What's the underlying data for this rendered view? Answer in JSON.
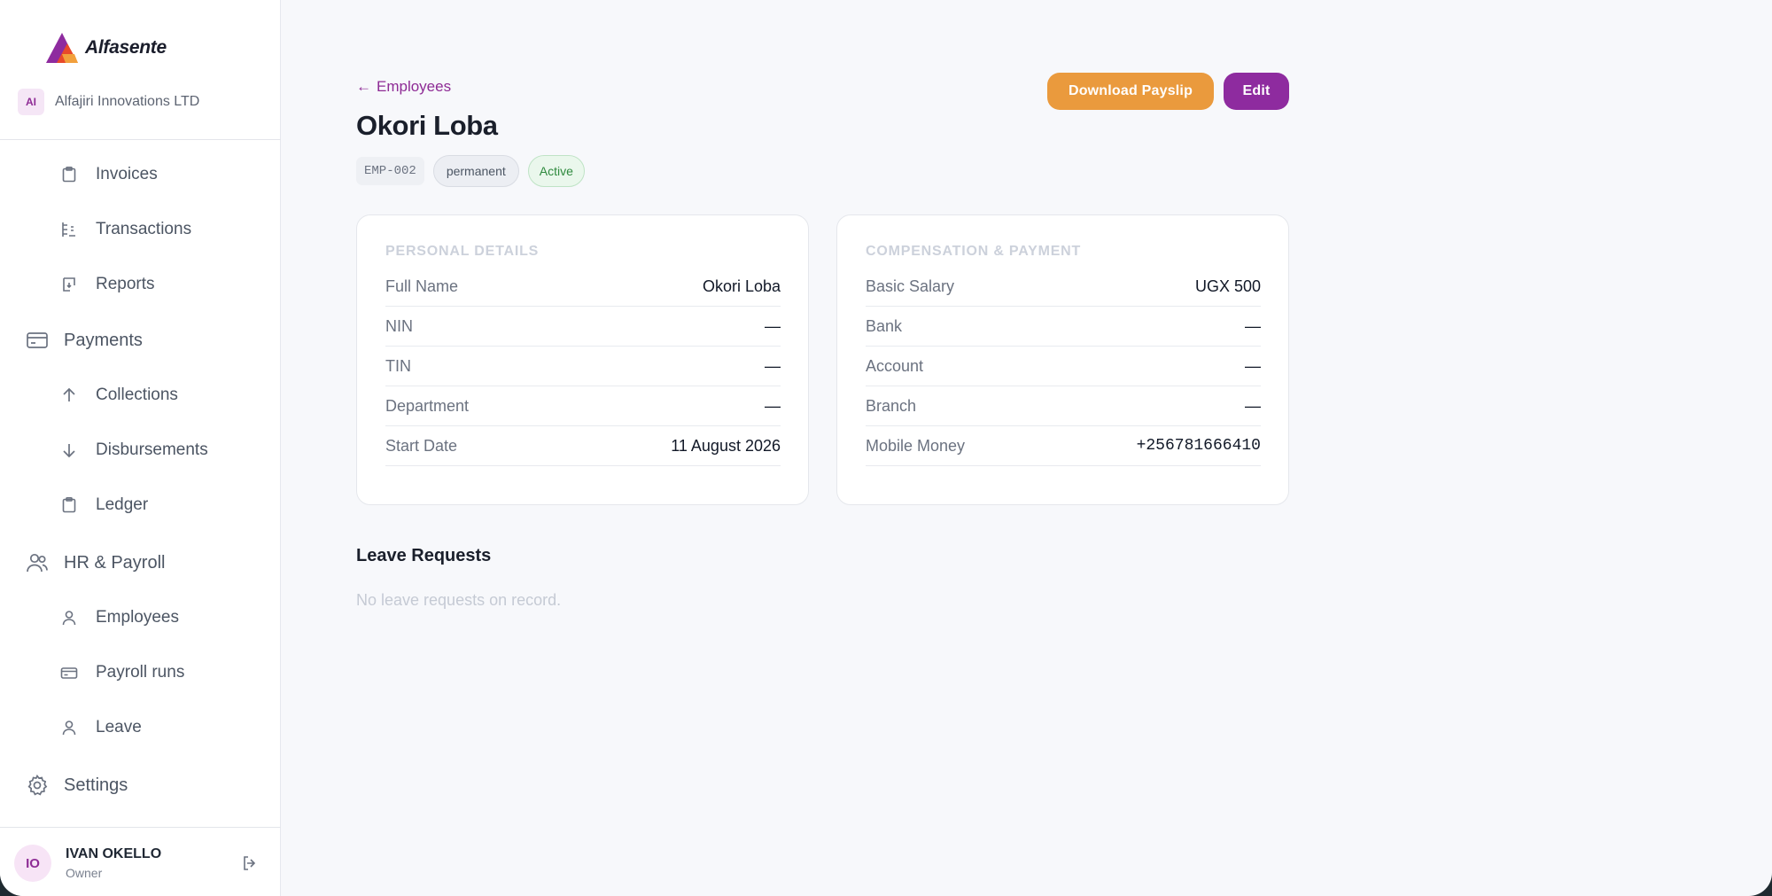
{
  "brand": {
    "name": "Alfasente"
  },
  "organization": {
    "initials": "AI",
    "name": "Alfajiri Innovations LTD"
  },
  "sidebar": {
    "items": [
      {
        "label": "Invoices",
        "icon": "clipboard-icon",
        "level": "sub"
      },
      {
        "label": "Transactions",
        "icon": "receipt-icon",
        "level": "sub"
      },
      {
        "label": "Reports",
        "icon": "report-icon",
        "level": "sub"
      },
      {
        "label": "Payments",
        "icon": "credit-card-icon",
        "level": "top"
      },
      {
        "label": "Collections",
        "icon": "arrow-up-icon",
        "level": "sub"
      },
      {
        "label": "Disbursements",
        "icon": "arrow-down-icon",
        "level": "sub"
      },
      {
        "label": "Ledger",
        "icon": "clipboard-icon",
        "level": "sub"
      },
      {
        "label": "HR & Payroll",
        "icon": "users-icon",
        "level": "top"
      },
      {
        "label": "Employees",
        "icon": "user-icon",
        "level": "sub"
      },
      {
        "label": "Payroll runs",
        "icon": "card-icon",
        "level": "sub"
      },
      {
        "label": "Leave",
        "icon": "user-icon",
        "level": "sub"
      },
      {
        "label": "Settings",
        "icon": "gear-icon",
        "level": "top"
      }
    ]
  },
  "user": {
    "initials": "IO",
    "name": "IVAN OKELLO",
    "role": "Owner"
  },
  "header": {
    "back_label": "Employees",
    "title": "Okori Loba",
    "employee_code": "EMP-002",
    "employment_type": "permanent",
    "status": "Active",
    "download_label": "Download Payslip",
    "edit_label": "Edit"
  },
  "personal_details": {
    "heading": "Personal Details",
    "rows": [
      {
        "key": "Full Name",
        "value": "Okori Loba"
      },
      {
        "key": "NIN",
        "value": "—"
      },
      {
        "key": "TIN",
        "value": "—"
      },
      {
        "key": "Department",
        "value": "—"
      },
      {
        "key": "Start Date",
        "value": "11 August 2026"
      }
    ]
  },
  "compensation": {
    "heading": "Compensation & Payment",
    "rows": [
      {
        "key": "Basic Salary",
        "value": "UGX 500"
      },
      {
        "key": "Bank",
        "value": "—"
      },
      {
        "key": "Account",
        "value": "—"
      },
      {
        "key": "Branch",
        "value": "—"
      },
      {
        "key": "Mobile Money",
        "value": "+256781666410"
      }
    ]
  },
  "leave": {
    "title": "Leave Requests",
    "empty_text": "No leave requests on record."
  },
  "colors": {
    "accent": "#8e2b9f",
    "download": "#ea9a3d",
    "status_active": "#2f8a3e"
  }
}
